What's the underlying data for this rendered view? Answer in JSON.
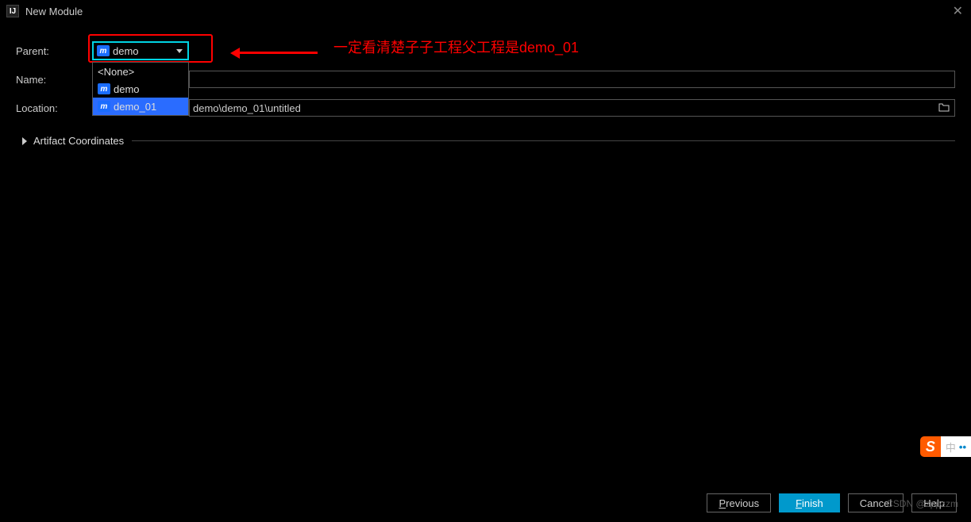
{
  "titlebar": {
    "title": "New Module"
  },
  "form": {
    "parent_label": "Parent:",
    "parent_value": "demo",
    "dropdown": {
      "none": "<None>",
      "demo": "demo",
      "demo01": "demo_01"
    },
    "name_label": "Name:",
    "location_label": "Location:",
    "location_suffix": "demo\\demo_01\\untitled"
  },
  "annotation": "一定看清楚子子工程父工程是demo_01",
  "artifact": {
    "label": "Artifact Coordinates"
  },
  "buttons": {
    "previous": "Previous",
    "previous_ul": "P",
    "finish": "Finish",
    "finish_ul": "F",
    "cancel": "Cancel",
    "help": "Help"
  },
  "watermark": "CSDN @zppzzm",
  "ime": {
    "s": "S",
    "cn": "中"
  }
}
